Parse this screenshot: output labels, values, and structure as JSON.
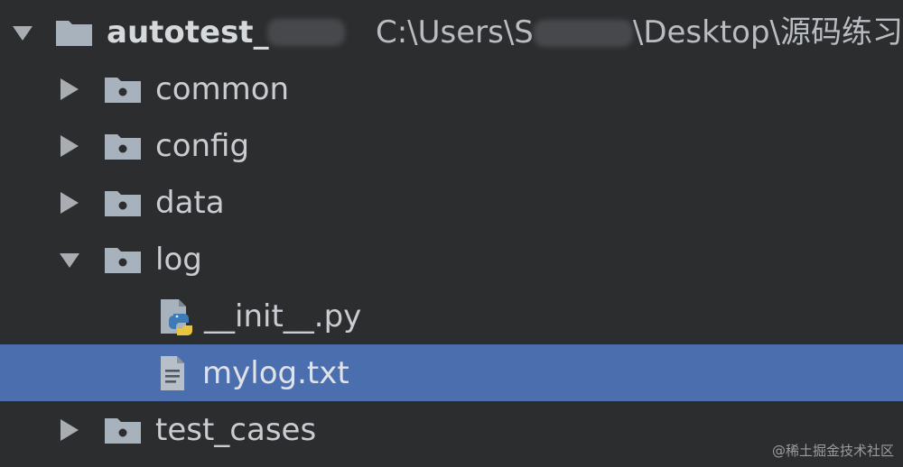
{
  "tree": {
    "root": {
      "label": "autotest_",
      "path_prefix": "C:\\Users\\S",
      "path_suffix": "\\Desktop\\源码练习",
      "expanded": true
    },
    "items": [
      {
        "label": "common",
        "type": "folder",
        "expanded": false
      },
      {
        "label": "config",
        "type": "folder",
        "expanded": false
      },
      {
        "label": "data",
        "type": "folder",
        "expanded": false
      },
      {
        "label": "log",
        "type": "folder",
        "expanded": true
      },
      {
        "label": "__init__.py",
        "type": "python-file"
      },
      {
        "label": "mylog.txt",
        "type": "text-file",
        "selected": true
      },
      {
        "label": "test_cases",
        "type": "folder",
        "expanded": false
      }
    ]
  },
  "watermark": "@稀土掘金技术社区",
  "colors": {
    "background": "#2b2d2f",
    "selection": "#4b6eaf",
    "folder": "#a8b2bd",
    "text": "#c9cdd1"
  }
}
